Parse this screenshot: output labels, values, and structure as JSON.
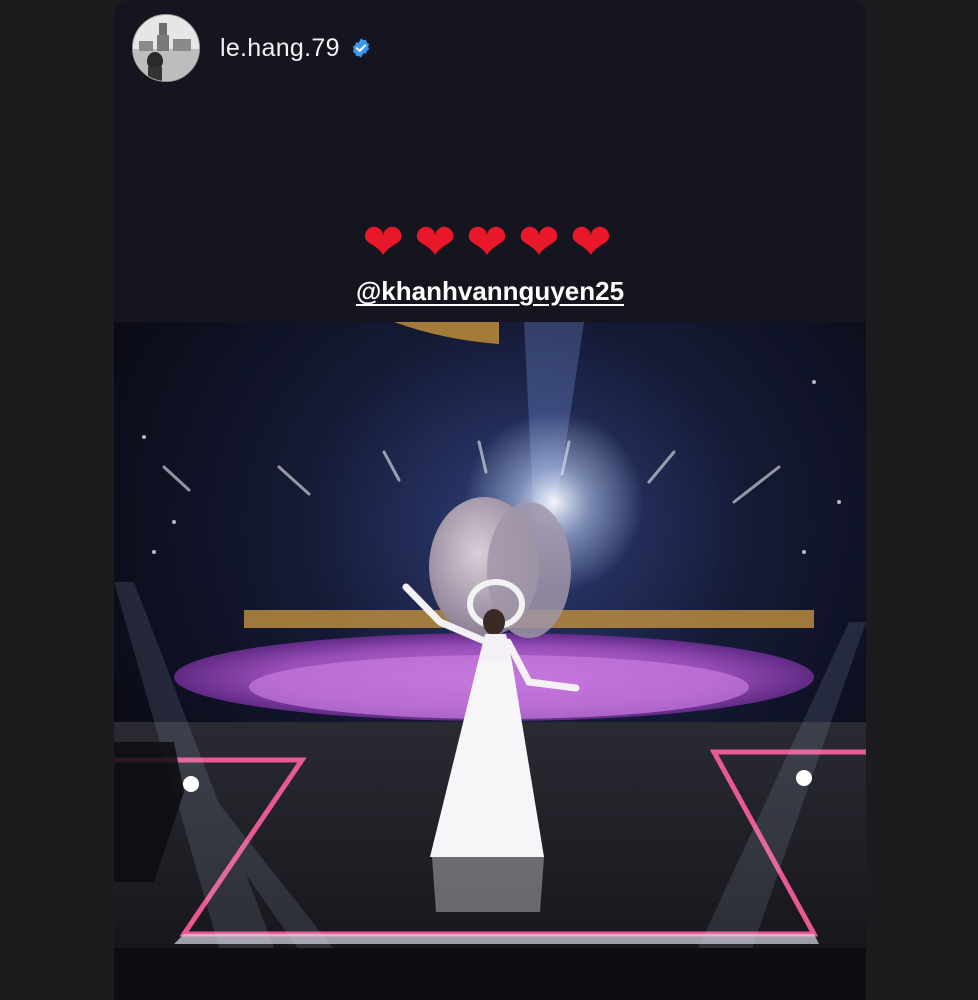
{
  "story": {
    "username": "le.hang.79",
    "verified": true,
    "hearts": [
      "❤",
      "❤",
      "❤",
      "❤",
      "❤"
    ],
    "mention": "@khanhvannguyen25"
  },
  "colors": {
    "background": "#1c1c1e",
    "story_bg": "#15151f",
    "heart": "#e8182a",
    "verified_badge": "#3897f0"
  },
  "media": {
    "type": "photo",
    "icon_names": [
      "avatar",
      "verified-badge-icon",
      "heart-icon"
    ]
  }
}
